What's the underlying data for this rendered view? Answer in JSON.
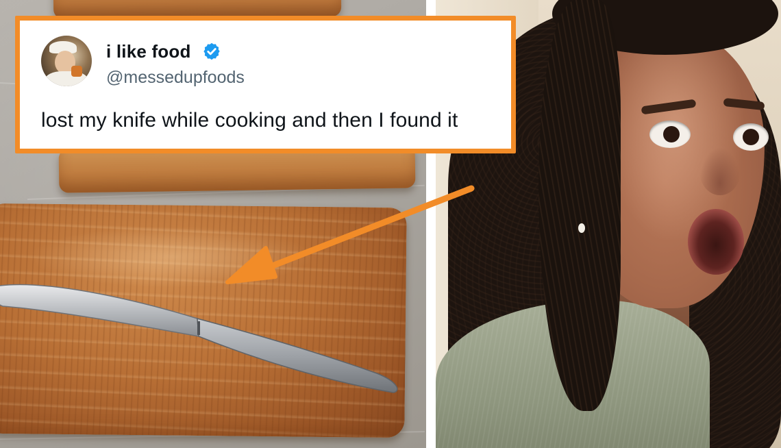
{
  "tweet": {
    "display_name": "i like food",
    "handle": "@messedupfoods",
    "text": "lost my knife while cooking and then I found it",
    "avatar_icon": "avatar-photo",
    "verified_icon": "verified-badge-icon",
    "verified_color": "#1d9bf0"
  },
  "colors": {
    "accent_border": "#f28c28",
    "arrow": "#f28c28",
    "name_text": "#0f1419",
    "handle_text": "#536471"
  },
  "left_photo": {
    "description_icon": "pastry-with-knife-photo"
  },
  "right_photo": {
    "description_icon": "shocked-person-photo"
  }
}
